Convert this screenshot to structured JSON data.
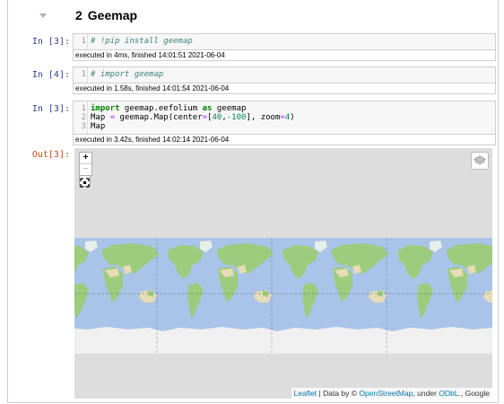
{
  "section": {
    "number": "2",
    "title": "Geemap"
  },
  "cells": [
    {
      "prompt": "In [3]:",
      "line_numbers": "1",
      "code": [
        {
          "tokens": [
            {
              "t": "# !pip install geemap",
              "c": "cm"
            }
          ]
        }
      ],
      "exec_status": "executed in 4ms, finished 14:01:51 2021-06-04"
    },
    {
      "prompt": "In [4]:",
      "line_numbers": "1",
      "code": [
        {
          "tokens": [
            {
              "t": "# import geemap",
              "c": "cm"
            }
          ]
        }
      ],
      "exec_status": "executed in 1.58s, finished 14:01:54 2021-06-04"
    },
    {
      "prompt": "In [3]:",
      "line_numbers": "1\n2\n3",
      "code": [
        {
          "tokens": [
            {
              "t": "import",
              "c": "kw"
            },
            {
              "t": " geemap.eefolium ",
              "c": ""
            },
            {
              "t": "as",
              "c": "kw"
            },
            {
              "t": " geemap",
              "c": ""
            }
          ]
        },
        {
          "tokens": [
            {
              "t": "Map ",
              "c": ""
            },
            {
              "t": "=",
              "c": "op"
            },
            {
              "t": " geemap.Map(center",
              "c": ""
            },
            {
              "t": "=",
              "c": "op"
            },
            {
              "t": "[",
              "c": ""
            },
            {
              "t": "40",
              "c": "nm"
            },
            {
              "t": ",",
              "c": ""
            },
            {
              "t": "-100",
              "c": "nm"
            },
            {
              "t": "], zoom",
              "c": ""
            },
            {
              "t": "=",
              "c": "op"
            },
            {
              "t": "4",
              "c": "nm"
            },
            {
              "t": ")",
              "c": ""
            }
          ]
        },
        {
          "tokens": [
            {
              "t": "Map",
              "c": ""
            }
          ]
        }
      ],
      "exec_status": "executed in 3.42s, finished 14:02:14 2021-06-04"
    }
  ],
  "output": {
    "prompt": "Out[3]:",
    "map": {
      "zoom_in": "+",
      "zoom_out": "−",
      "attribution": {
        "leaflet": "Leaflet",
        "data_by": "| Data by ©",
        "osm": "OpenStreetMap",
        "under": ", under",
        "odbl": "ODbL",
        "google": "., Google"
      }
    }
  },
  "colors": {
    "ocean": "#a9c4e8",
    "land": "#9ccc7c",
    "desert": "#e6dcb6",
    "ice": "#f0f0f0",
    "map_bg": "#dddddd",
    "prompt_in": "#303f9f",
    "prompt_out": "#d84315"
  }
}
